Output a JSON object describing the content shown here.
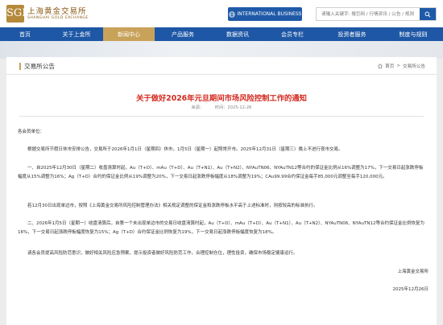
{
  "header": {
    "logo_mark": "SGE",
    "logo_cn": "上海黄金交易所",
    "logo_en": "SHANGHAI GOLD EXCHANGE",
    "intl_button": "INTERNATIONAL BUSINESS",
    "search_placeholder": "请输入关键字: 搜巨网 / 行情资讯 / 公告 / 规则"
  },
  "nav": {
    "items": [
      {
        "label": "首页",
        "active": false
      },
      {
        "label": "关于上金所",
        "active": false
      },
      {
        "label": "新闻中心",
        "active": true
      },
      {
        "label": "产品服务",
        "active": false
      },
      {
        "label": "数据资讯",
        "active": false
      },
      {
        "label": "会员专栏",
        "active": false
      },
      {
        "label": "投资者服务",
        "active": false
      },
      {
        "label": "制度与规则",
        "active": false
      }
    ]
  },
  "section": {
    "title": "交易所公告",
    "breadcrumb_home": "首页",
    "breadcrumb_sep": ">",
    "breadcrumb_current": "交易所公告"
  },
  "article": {
    "title": "关于做好2026年元旦期间市场风险控制工作的通知",
    "source_label": "来源：",
    "date_label": "时间：2025-12-26",
    "greeting": "各会员单位：",
    "para1": "根据交易所节假日休市安排公告，交易所于2026年1月1日（星期四）休市，1月5日（星期一）起照常开市。2025年12月31日（星期三）晚上不进行夜市交易。",
    "para2": "一、自2025年12月30日（星期二）收盘清算时起，Au（T+D）、mAu（T+D）、Au（T+N1）、Au（T+N2）、NYAuTN06、NYAuTN12等合约的保证金比例从16%调整为17%，下一交易日起涨跌停板幅度从15%调整为16%；Ag（T+D）合约的保证金比例从19%调整为20%，下一交易日起涨跌停板幅度从18%调整为19%；CAu99.99合约保证金每手85,000元调整至每手120,000元。",
    "para3": "若12月30日出现单边市，按照《上海黄金交易所风险控制管理办法》相关规定调整的保证金和涨跌停板水平高于上述标准时，则按较高的标准执行。",
    "para4": "二、2026年1月5日（星期一）收盘清算后，自第一个未出现单边市的交易日收盘清算时起，Au（T+D）、mAu（T+D）、Au（T+N1）、Au（T+N2）、NYAuTN06、NYAuTN12等合约保证金比例恢复为16%，下一交易日起涨跌停板幅度恢复为15%；Ag（T+D）合约保证金比例恢复为19%，下一交易日起涨跌停板幅度恢复为18%。",
    "para5": "请各会员提高风险防范意识，做好相关风险应急预案，提示投资者做好风险防范工作，合理控制仓位，理性投资，确保市场稳定健康运行。",
    "signature": "上海黄金交易所",
    "sign_date": "2025年12月26日"
  },
  "colors": {
    "nav_bg": "#1d57a5",
    "nav_active": "#c9a25a",
    "title_red": "#d42a20",
    "brand_gold": "#b5893a"
  }
}
